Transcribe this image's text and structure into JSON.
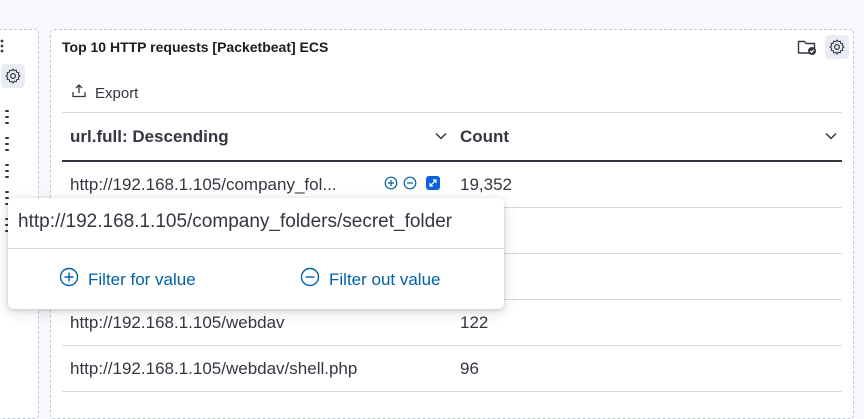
{
  "panel": {
    "title": "Top 10 HTTP requests [Packetbeat] ECS",
    "export_label": "Export"
  },
  "table": {
    "columns": [
      {
        "label": "url.full: Descending",
        "icon": "chevron-down-icon"
      },
      {
        "label": "Count",
        "icon": "chevron-down-icon"
      }
    ],
    "rows": [
      {
        "url": "http://192.168.1.105/company_fol...",
        "count": "19,352"
      },
      {
        "url": "",
        "count": ""
      },
      {
        "url": "",
        "count": ""
      },
      {
        "url": "http://192.168.1.105/webdav",
        "count": "122"
      },
      {
        "url": "http://192.168.1.105/webdav/shell.php",
        "count": "96"
      }
    ]
  },
  "popover": {
    "value": "http://192.168.1.105/company_folders/secret_folder",
    "filter_for_label": "Filter for value",
    "filter_out_label": "Filter out value"
  },
  "colors": {
    "accent": "#0061a6",
    "expand_button": "#0b64dd",
    "border": "#d3dae6",
    "text": "#343741"
  },
  "icons": [
    "gear-icon",
    "folder-check-icon",
    "export-icon",
    "chevron-down-icon",
    "plus-circle-icon",
    "minus-circle-icon",
    "expand-icon",
    "drag-handle-icon"
  ]
}
